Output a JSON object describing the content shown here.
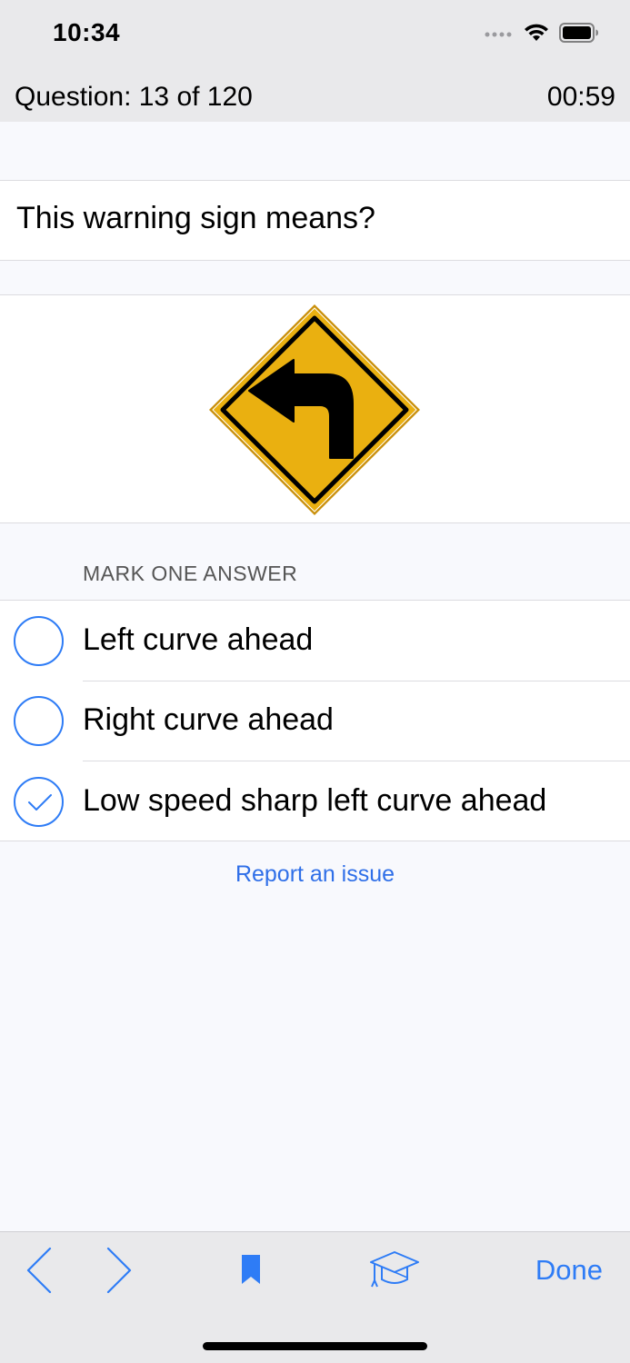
{
  "status_bar": {
    "time": "10:34",
    "icons": [
      "signal-dots-icon",
      "wifi-icon",
      "battery-icon"
    ]
  },
  "header": {
    "question_counter": "Question: 13 of 120",
    "timer": "00:59"
  },
  "question": {
    "text": "This warning sign means?",
    "image_icon": "left-turn-warning-sign-icon"
  },
  "answers": {
    "section_title": "MARK ONE ANSWER",
    "options": [
      {
        "label": "Left curve ahead",
        "selected": false
      },
      {
        "label": "Right curve ahead",
        "selected": false
      },
      {
        "label": "Low speed sharp left curve ahead",
        "selected": true
      }
    ]
  },
  "report_link": "Report an issue",
  "toolbar": {
    "prev_icon": "chevron-left-icon",
    "next_icon": "chevron-right-icon",
    "bookmark_icon": "bookmark-icon",
    "study_icon": "graduation-cap-icon",
    "done_label": "Done"
  },
  "colors": {
    "accent": "#2e7cf6",
    "link": "#2f6fe8",
    "sign_yellow": "#eab010",
    "bar_gray": "#e9e9eb",
    "background": "#f8f9fd"
  }
}
